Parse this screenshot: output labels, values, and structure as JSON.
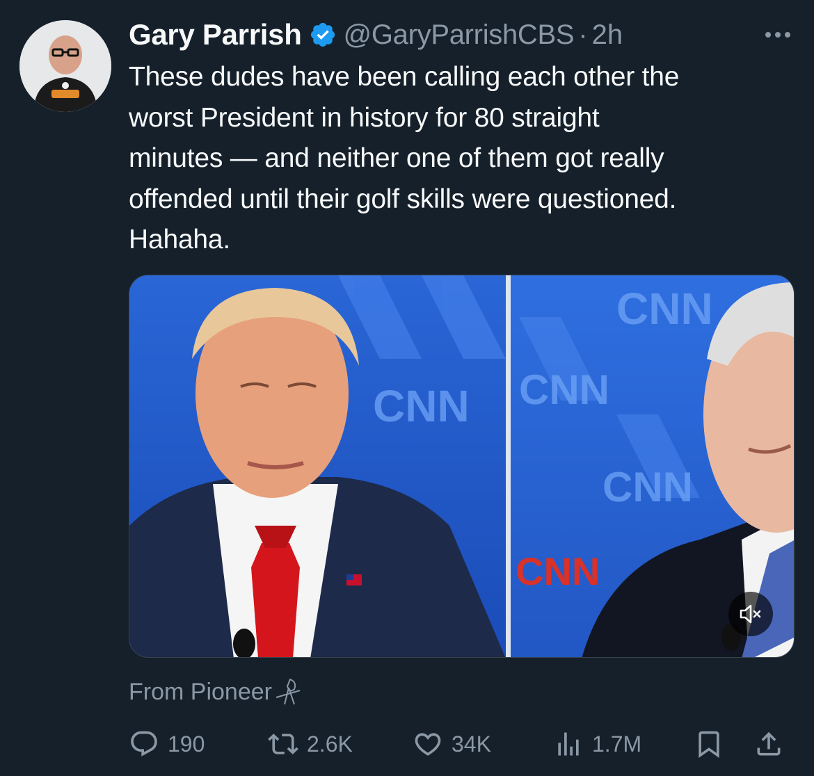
{
  "tweet": {
    "author": {
      "name": "Gary Parrish",
      "handle": "@GaryParrishCBS",
      "verified": true,
      "verified_color": "#1d9bf0",
      "avatar_icon": "profile-photo"
    },
    "separator": "·",
    "time": "2h",
    "more_icon": "more-horizontal-icon",
    "text": "These dudes have been calling each other the\nworst President in history for 80 straight\nminutes — and neither one of them got really\noffended until their golf skills were questioned.\nHahaha.",
    "media": {
      "type": "video",
      "mute_icon": "volume-muted-icon",
      "overlay_texts": [
        "CNN",
        "CNN",
        "CNN",
        "CNN",
        "CNN"
      ]
    },
    "source": {
      "label": "From Pioneer",
      "icon": "pioneer-logo"
    },
    "actions": {
      "replies": "190",
      "retweets": "2.6K",
      "likes": "34K",
      "views": "1.7M",
      "bookmark_icon": "bookmark-icon",
      "share_icon": "share-icon"
    }
  },
  "colors": {
    "background": "#15202b",
    "text_primary": "#f7f9f9",
    "text_secondary": "#8b98a5",
    "accent": "#1d9bf0"
  }
}
